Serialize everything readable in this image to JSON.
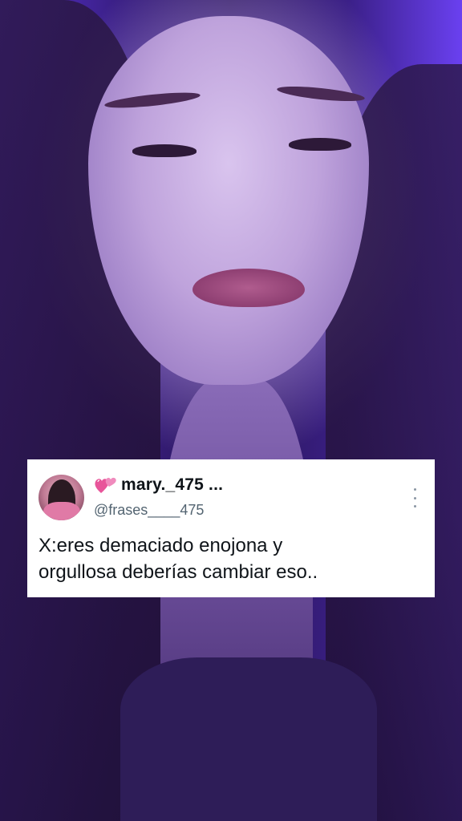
{
  "post": {
    "display_name": "mary._475 ...",
    "handle": "@frases____475",
    "text_lines": [
      "X:eres demaciado enojona y",
      "orgullosa deberías cambiar eso.."
    ],
    "badge_icon": "two-hearts-icon",
    "menu_icon": "more-vertical-icon"
  },
  "colors": {
    "background_accent": "#5a32d6",
    "card_bg": "#ffffff",
    "name_color": "#0f1419",
    "handle_color": "#536471",
    "heart_color": "#e8559a"
  }
}
